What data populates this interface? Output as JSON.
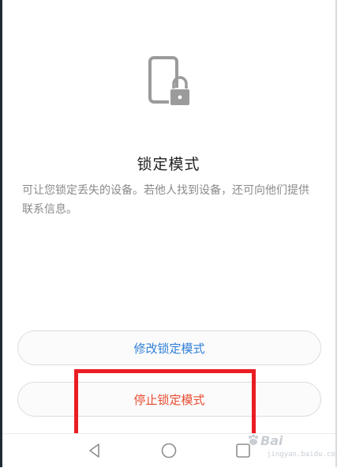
{
  "screen": {
    "title": "锁定模式",
    "description": "可让您锁定丢失的设备。若他人找到设备，还可向他们提供联系信息。"
  },
  "buttons": {
    "modify_label": "修改锁定模式",
    "stop_label": "停止锁定模式"
  },
  "annotation": {
    "highlight_color": "#ea1d23",
    "target": "stop-lock-mode-button"
  },
  "navbar": {
    "icons": [
      "back-icon",
      "home-icon",
      "recent-apps-icon"
    ]
  },
  "watermark": {
    "brand": "Bai",
    "url": "jingyan.baidu.com"
  },
  "colors": {
    "modify_text": "#2f7fd7",
    "stop_text": "#e94a2f",
    "icon_gray": "#9b9b9b"
  }
}
